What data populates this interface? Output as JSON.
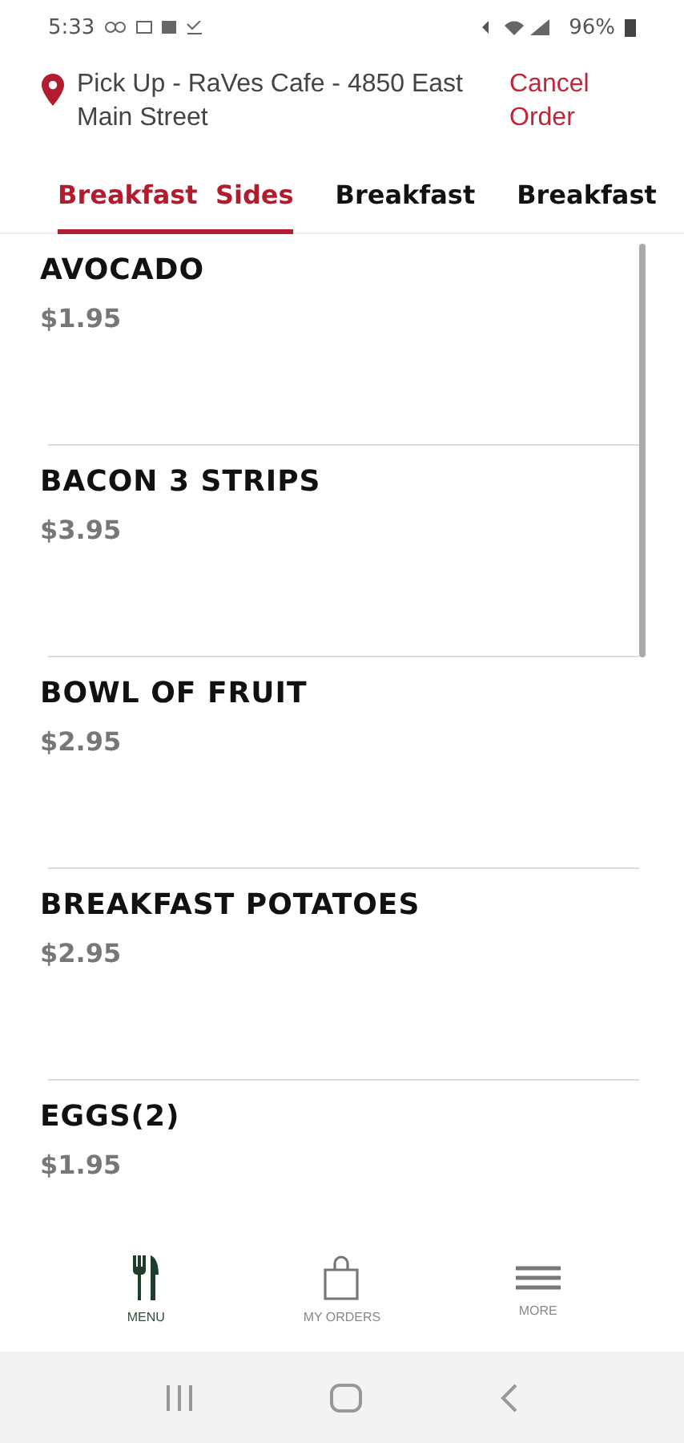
{
  "status_bar": {
    "time": "5:33",
    "battery": "96%"
  },
  "header": {
    "location": "Pick Up - RaVes Cafe - 4850 East Main Street",
    "cancel": "Cancel Order"
  },
  "tabs": [
    {
      "label": "Breakfast  Sides",
      "selected": true
    },
    {
      "label": "Breakfast",
      "selected": false
    },
    {
      "label": "Breakfast",
      "selected": false
    }
  ],
  "items": [
    {
      "name": "AVOCADO",
      "price": "$1.95"
    },
    {
      "name": "BACON 3 STRIPS",
      "price": "$3.95"
    },
    {
      "name": "BOWL OF FRUIT",
      "price": "$2.95"
    },
    {
      "name": "BREAKFAST POTATOES",
      "price": "$2.95"
    },
    {
      "name": "EGGS(2)",
      "price": "$1.95"
    }
  ],
  "bottom_nav": [
    {
      "kind": "menu",
      "label": "MENU",
      "selected": true
    },
    {
      "kind": "orders",
      "label": "MY ORDERS",
      "selected": false
    },
    {
      "kind": "more",
      "label": "MORE",
      "selected": false
    }
  ]
}
